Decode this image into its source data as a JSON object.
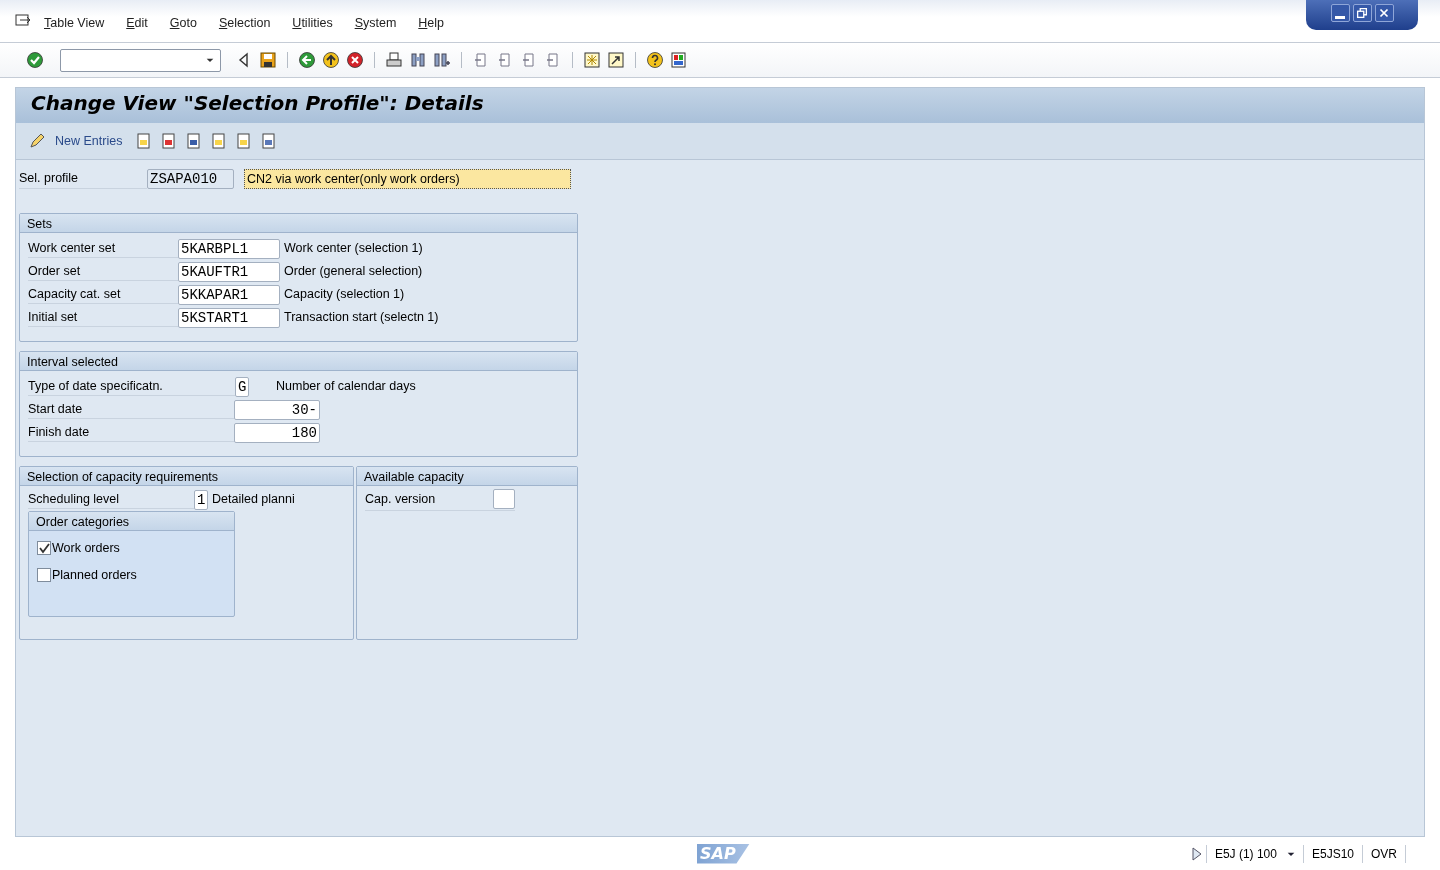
{
  "menu": [
    {
      "label": "Table View"
    },
    {
      "label": "Edit"
    },
    {
      "label": "Goto"
    },
    {
      "label": "Selection"
    },
    {
      "label": "Utilities"
    },
    {
      "label": "System"
    },
    {
      "label": "Help"
    }
  ],
  "screen_title": "Change View \"Selection Profile\": Details",
  "app_toolbar": {
    "new_entries": "New Entries"
  },
  "sel_profile": {
    "label": "Sel. profile",
    "value": "ZSAPA010",
    "description": "CN2 via work center(only work orders)"
  },
  "sets": {
    "title": "Sets",
    "rows": [
      {
        "label": "Work center set",
        "value": "5KARBPL1",
        "description": "Work center (selection 1)"
      },
      {
        "label": "Order set",
        "value": "5KAUFTR1",
        "description": "Order (general selection)"
      },
      {
        "label": "Capacity cat. set",
        "value": "5KKAPAR1",
        "description": "Capacity (selection 1)"
      },
      {
        "label": "Initial set",
        "value": "5KSTART1",
        "description": "Transaction start (selectn 1)"
      }
    ]
  },
  "interval": {
    "title": "Interval selected",
    "rows": [
      {
        "kind": "code",
        "label": "Type of date specificatn.",
        "value": "G",
        "description": "Number of calendar days"
      },
      {
        "kind": "number",
        "label": "Start date",
        "value": "30-"
      },
      {
        "kind": "number",
        "label": "Finish date",
        "value": "180"
      }
    ]
  },
  "capacity_requirements": {
    "title": "Selection of capacity requirements",
    "scheduling_level": {
      "label": "Scheduling level",
      "value": "1",
      "description": "Detailed planni"
    },
    "order_categories": {
      "title": "Order categories",
      "items": [
        {
          "label": "Work orders",
          "checked": true
        },
        {
          "label": "Planned orders",
          "checked": false
        }
      ]
    }
  },
  "available_capacity": {
    "title": "Available capacity",
    "cap_version": {
      "label": "Cap. version"
    }
  },
  "status_bar": {
    "logo": "SAP",
    "system": "E5J (1) 100",
    "server": "E5JS10",
    "mode": "OVR"
  }
}
